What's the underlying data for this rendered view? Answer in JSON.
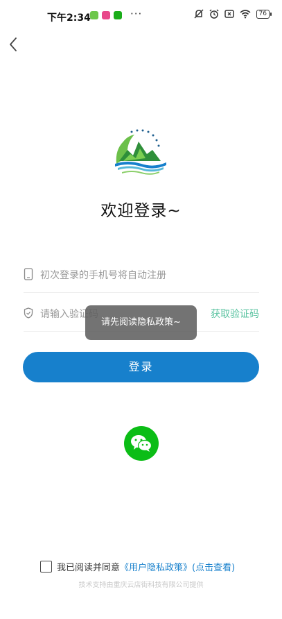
{
  "status_bar": {
    "time": "下午2:34",
    "dots": "···",
    "battery": "76",
    "notification_icons": [
      "green-app-icon",
      "pink-app-icon",
      "wechat-app-icon"
    ],
    "system_icons": [
      "mute-icon",
      "alarm-icon",
      "close-box-icon",
      "wifi-icon",
      "battery-icon"
    ]
  },
  "header": {
    "back_icon": "chevron-left-icon"
  },
  "welcome_title": "欢迎登录~",
  "phone_field": {
    "placeholder": "初次登录的手机号将自动注册",
    "icon": "phone-icon"
  },
  "code_field": {
    "placeholder": "请输入验证码",
    "icon": "shield-icon",
    "get_code_label": "获取验证码"
  },
  "toast": {
    "message": "请先阅读隐私政策~"
  },
  "login_button": {
    "label": "登录"
  },
  "wechat_login": {
    "icon": "wechat-icon"
  },
  "agreement": {
    "prefix": "我已阅读并同意",
    "policy_link": "《用户隐私政策》",
    "view_link": "(点击查看)",
    "checked": false
  },
  "footer_note": "技术支持由重庆云店街科技有限公司提供",
  "colors": {
    "primary": "#1780cc",
    "accent_green": "#5bc3a1",
    "wechat": "#0bbd16",
    "toast_bg": "#606060"
  }
}
